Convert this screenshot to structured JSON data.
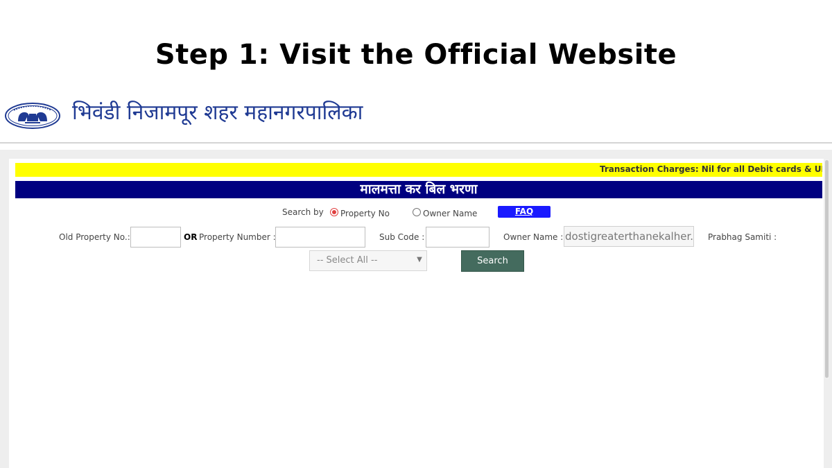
{
  "step_title": "Step 1: Visit the Official Website",
  "header": {
    "site_name": "भिवंडी निजामपूर शहर महानगरपालिका",
    "logo_icon": "municipal-emblem-icon"
  },
  "ticker": {
    "text": "Transaction Charges: Nil for all Debit cards & UPI Pa"
  },
  "band": {
    "title": "मालमत्ता कर बिल भरणा"
  },
  "search_by": {
    "label": "Search by",
    "options": [
      {
        "label": "Property No",
        "selected": true
      },
      {
        "label": "Owner Name",
        "selected": false
      }
    ],
    "faq_label": "FAQ"
  },
  "form": {
    "old_property_label": "Old Property No.:",
    "old_property_value": "",
    "or_label": "OR",
    "property_number_label": "Property Number :",
    "property_number_value": "",
    "sub_code_label": "Sub Code :",
    "sub_code_value": "",
    "owner_name_label": "Owner Name :",
    "owner_name_value": "dostigreaterthanekalher.in",
    "prabhag_label": "Prabhag Samiti :",
    "prabhag_selected": "-- Select All --",
    "search_label": "Search"
  },
  "colors": {
    "ticker_bg": "#ffff00",
    "band_bg": "#000080",
    "faq_bg": "#1a1aff",
    "search_bg": "#446b5e",
    "radio_selected": "#e04040",
    "site_name": "#1f3a93"
  }
}
